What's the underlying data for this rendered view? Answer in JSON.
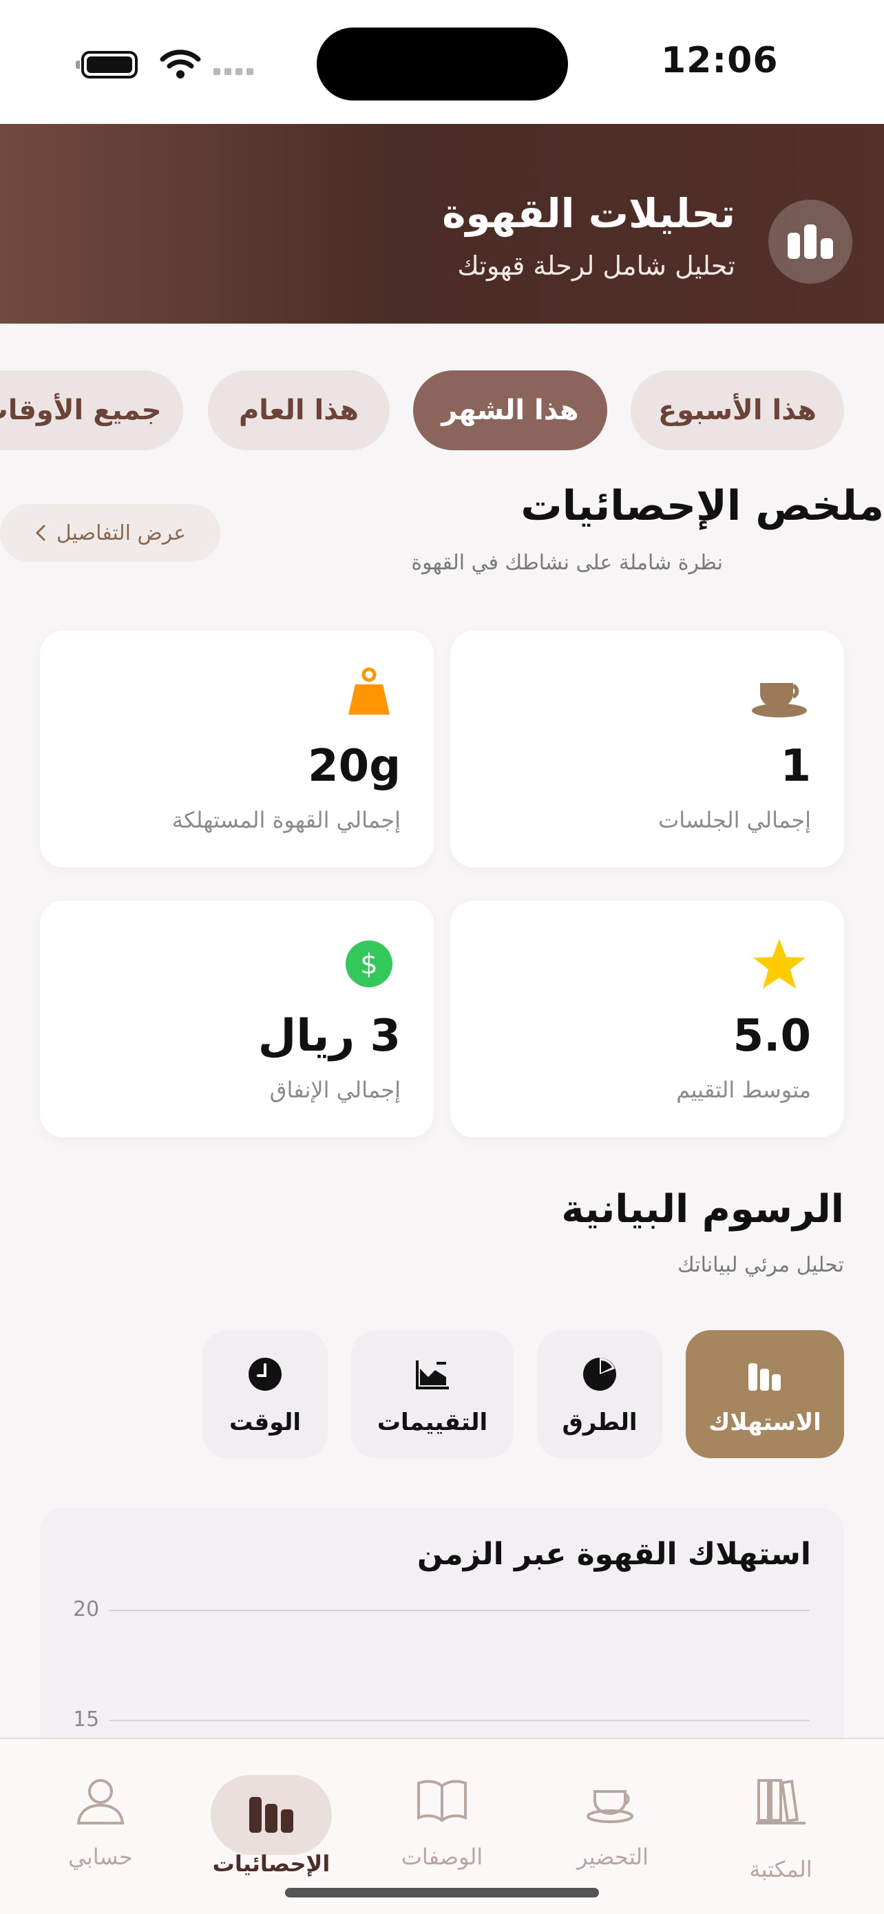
{
  "status_bar": {
    "time": "12:06"
  },
  "header": {
    "title": "تحليلات القهوة",
    "subtitle": "تحليل شامل لرحلة قهوتك",
    "icon": "bar-chart-icon"
  },
  "filters": [
    {
      "label": "هذا الأسبوع",
      "active": false
    },
    {
      "label": "هذا الشهر",
      "active": true
    },
    {
      "label": "هذا العام",
      "active": false
    },
    {
      "label": "جميع الأوقات",
      "active": false
    }
  ],
  "summary": {
    "title": "ملخص الإحصائيات",
    "subtitle": "نظرة شاملة على نشاطك في القهوة",
    "details_button": "عرض التفاصيل",
    "cards": [
      {
        "value": "1",
        "label": "إجمالي الجلسات",
        "icon": "coffee-cup-icon",
        "color": "#9b7a5a"
      },
      {
        "value": "20g",
        "label": "إجمالي القهوة المستهلكة",
        "icon": "scale-weight-icon",
        "color": "#ff9500"
      },
      {
        "value": "5.0",
        "label": "متوسط التقييم",
        "icon": "star-icon",
        "color": "#ffcc00"
      },
      {
        "value": "3 ريال",
        "label": "إجمالي الإنفاق",
        "icon": "dollar-icon",
        "color": "#34c759"
      }
    ]
  },
  "charts": {
    "title": "الرسوم البيانية",
    "subtitle": "تحليل مرئي لبياناتك",
    "tabs": [
      {
        "label": "الاستهلاك",
        "icon": "bar-chart-icon",
        "active": true
      },
      {
        "label": "الطرق",
        "icon": "pie-chart-icon",
        "active": false
      },
      {
        "label": "التقييمات",
        "icon": "trend-chart-icon",
        "active": false
      },
      {
        "label": "الوقت",
        "icon": "clock-icon",
        "active": false
      }
    ]
  },
  "chart_data": {
    "type": "bar",
    "title": "استهلاك القهوة عبر الزمن",
    "y_ticks": [
      "20",
      "15"
    ],
    "grid": true
  },
  "tabbar": [
    {
      "label": "المكتبة",
      "icon": "library-icon",
      "active": false
    },
    {
      "label": "التحضير",
      "icon": "coffee-cup-icon",
      "active": false
    },
    {
      "label": "الوصفات",
      "icon": "book-icon",
      "active": false
    },
    {
      "label": "الإحصائيات",
      "icon": "bar-chart-icon",
      "active": true
    },
    {
      "label": "حسابي",
      "icon": "person-icon",
      "active": false
    }
  ]
}
